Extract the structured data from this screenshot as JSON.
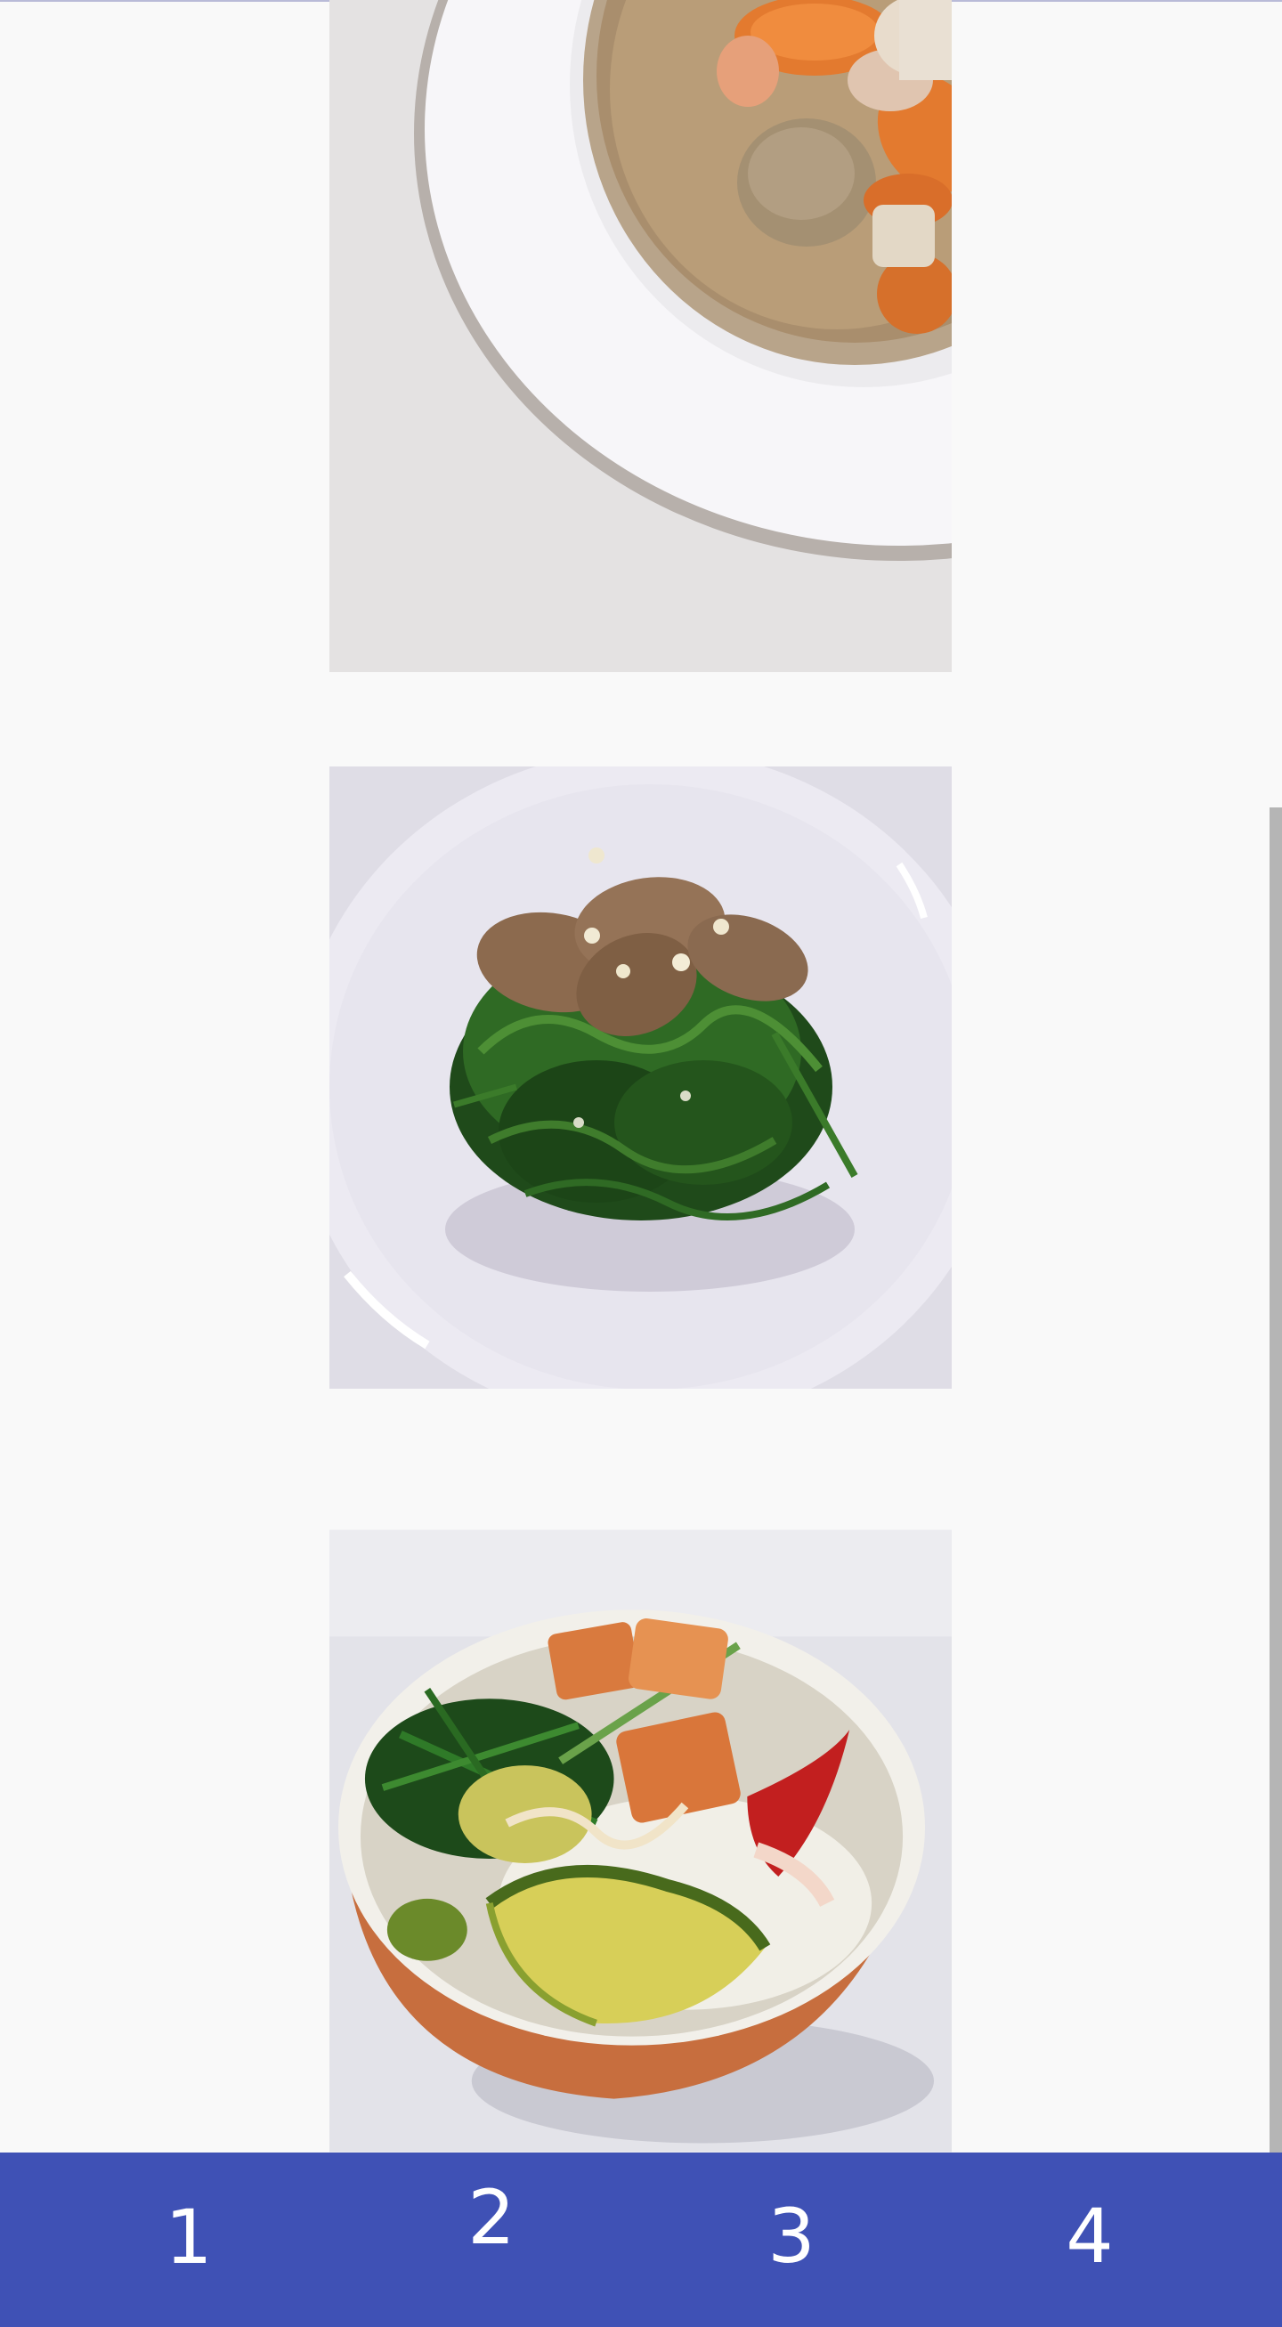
{
  "feed": {
    "photos": [
      {
        "subject": "soup-bowl-with-carrots-and-meatball"
      },
      {
        "subject": "greens-topped-with-sliced-meat"
      },
      {
        "subject": "rice-bowl-with-salmon-and-avocado"
      }
    ]
  },
  "tabbar": {
    "color": "#3f51b5",
    "tabs": [
      {
        "label": "1"
      },
      {
        "label": "2"
      },
      {
        "label": "3"
      },
      {
        "label": "4"
      }
    ]
  }
}
